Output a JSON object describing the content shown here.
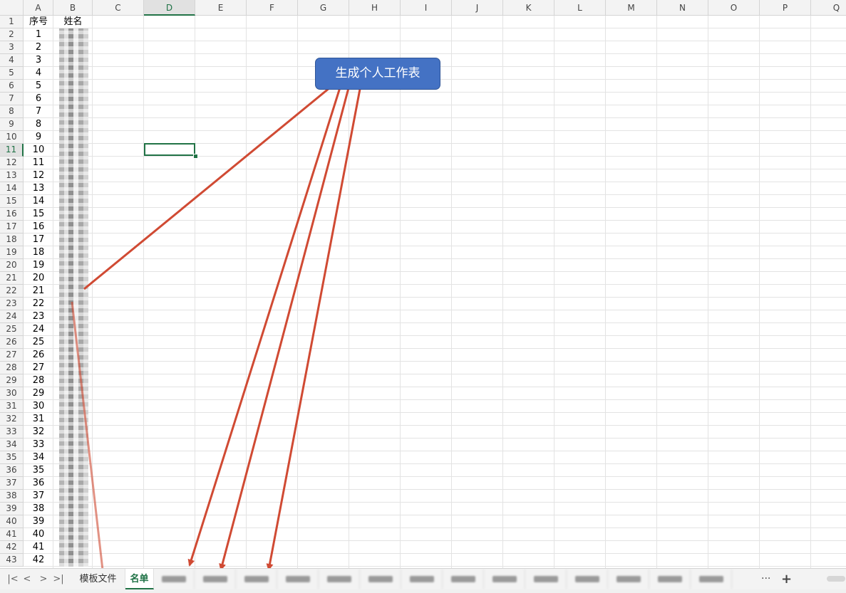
{
  "sheet": {
    "columns": [
      "A",
      "B",
      "C",
      "D",
      "E",
      "F",
      "G",
      "H",
      "I",
      "J",
      "K",
      "L",
      "M",
      "N",
      "O",
      "P",
      "Q"
    ],
    "selected_column": "D",
    "selected_row": 11,
    "rows": [
      "1",
      "2",
      "3",
      "4",
      "5",
      "6",
      "7",
      "8",
      "9",
      "10",
      "11",
      "12",
      "13",
      "14",
      "15",
      "16",
      "17",
      "18",
      "19",
      "20",
      "21",
      "22",
      "23",
      "24",
      "25",
      "26",
      "27",
      "28",
      "29",
      "30",
      "31",
      "32",
      "33",
      "34",
      "35",
      "36",
      "37",
      "38",
      "39",
      "40",
      "41",
      "42",
      "43"
    ],
    "header_cells": {
      "a1": "序号",
      "b1": "姓名"
    },
    "serial_numbers": [
      "1",
      "2",
      "3",
      "4",
      "5",
      "6",
      "7",
      "8",
      "9",
      "10",
      "11",
      "12",
      "13",
      "14",
      "15",
      "16",
      "17",
      "18",
      "19",
      "20",
      "21",
      "22",
      "23",
      "24",
      "25",
      "26",
      "27",
      "28",
      "29",
      "30",
      "31",
      "32",
      "33",
      "34",
      "35",
      "36",
      "37",
      "38",
      "39",
      "40",
      "41",
      "42"
    ]
  },
  "shape_button": {
    "label": "生成个人工作表"
  },
  "arrow_color": "#d04a33",
  "tabbar": {
    "nav": {
      "first": "|<",
      "prev": "<",
      "next": ">",
      "last": ">|"
    },
    "tabs": [
      {
        "label": "模板文件",
        "state": "normal"
      },
      {
        "label": "名单",
        "state": "active"
      },
      {
        "label": "",
        "state": "blurred"
      },
      {
        "label": "",
        "state": "blurred"
      },
      {
        "label": "",
        "state": "blurred"
      },
      {
        "label": "",
        "state": "blurred"
      },
      {
        "label": "",
        "state": "blurred"
      },
      {
        "label": "",
        "state": "blurred"
      },
      {
        "label": "",
        "state": "blurred"
      },
      {
        "label": "",
        "state": "blurred"
      },
      {
        "label": "",
        "state": "blurred"
      },
      {
        "label": "",
        "state": "blurred"
      },
      {
        "label": "",
        "state": "blurred"
      },
      {
        "label": "",
        "state": "blurred"
      },
      {
        "label": "",
        "state": "blurred"
      },
      {
        "label": "",
        "state": "blurred"
      }
    ],
    "more": "···",
    "add": "+"
  }
}
